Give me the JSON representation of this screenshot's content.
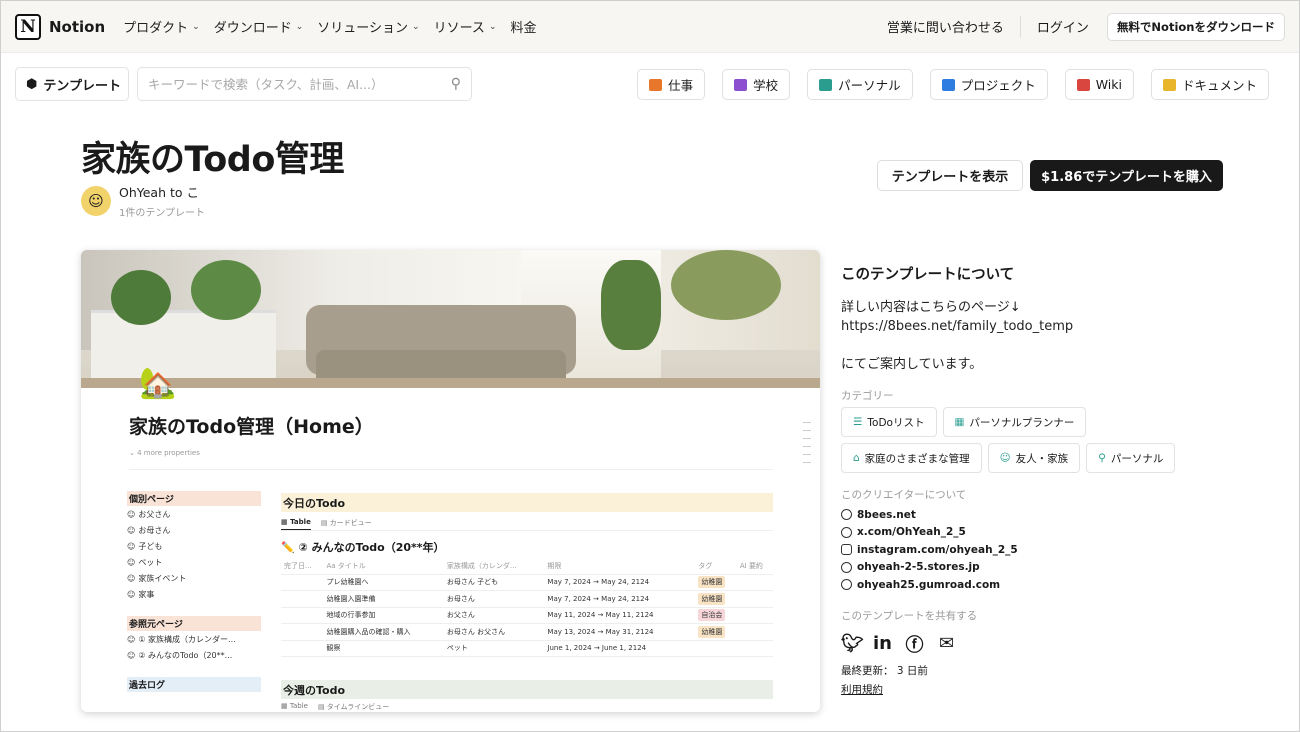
{
  "nav": {
    "brand": "Notion",
    "items": [
      "プロダクト",
      "ダウンロード",
      "ソリューション",
      "リソース",
      "料金"
    ],
    "has_chevron": [
      true,
      true,
      true,
      true,
      false
    ],
    "contact": "営業に問い合わせる",
    "login": "ログイン",
    "download": "無料でNotionをダウンロード"
  },
  "toolbar": {
    "templates_label": "テンプレート",
    "search_placeholder": "キーワードで検索（タスク、計画、AI...）",
    "categories": [
      {
        "label": "仕事",
        "color": "#e9772b"
      },
      {
        "label": "学校",
        "color": "#8b4fcf"
      },
      {
        "label": "パーソナル",
        "color": "#2a9d8f"
      },
      {
        "label": "プロジェクト",
        "color": "#2f7de1"
      },
      {
        "label": "Wiki",
        "color": "#d9463f"
      },
      {
        "label": "ドキュメント",
        "color": "#e8b52b"
      }
    ]
  },
  "template": {
    "title": "家族のTodo管理",
    "author": "OhYeah to こ",
    "author_sub": "1件のテンプレート",
    "view_button": "テンプレートを表示",
    "buy_button": "$1.86でテンプレートを購入"
  },
  "preview": {
    "page_title": "家族のTodo管理（Home）",
    "more_props": "4 more properties",
    "sections": [
      {
        "heading": "個別ページ",
        "color": "#f9e2d6",
        "items": [
          "お父さん",
          "お母さん",
          "子ども",
          "ペット",
          "家族イベント",
          "家事"
        ]
      },
      {
        "heading": "参照元ページ",
        "color": "#f9e2d6",
        "items": [
          "① 家族構成（カレンダー...",
          "② みんなのTodo（20**..."
        ]
      },
      {
        "heading": "過去ログ",
        "color": "#e3eef7",
        "items": []
      }
    ],
    "today": "今日のTodo",
    "tab_table": "Table",
    "tab_card": "カードビュー",
    "db_title": "② みんなのTodo（20**年）",
    "columns": [
      "完了日...",
      "Aa タイトル",
      "家族構成（カレンダ...",
      "期限",
      "タグ",
      "AI 要約"
    ],
    "rows": [
      {
        "title": "プレ幼稚園へ",
        "members": "お母さん  子ども",
        "date": "May 7, 2024 → May 24, 2124",
        "tag": "幼稚園",
        "tag_color": "#f8e3c4"
      },
      {
        "title": "幼稚園入園準備",
        "members": "お母さん",
        "date": "May 7, 2024 → May 24, 2124",
        "tag": "幼稚園",
        "tag_color": "#f8e3c4"
      },
      {
        "title": "地域の行事参加",
        "members": "お父さん",
        "date": "May 11, 2024 → May 11, 2124",
        "tag": "自治会",
        "tag_color": "#f7d6d9"
      },
      {
        "title": "幼稚園購入品の確認・購入",
        "members": "お母さん  お父さん",
        "date": "May 13, 2024 → May 31, 2124",
        "tag": "幼稚園",
        "tag_color": "#f8e3c4"
      },
      {
        "title": "観察",
        "members": "ペット",
        "date": "June 1, 2024 → June 1, 2124",
        "tag": "",
        "tag_color": "#ffffff"
      }
    ],
    "week": "今週のTodo",
    "week_tab2": "タイムラインビュー"
  },
  "info": {
    "heading": "このテンプレートについて",
    "desc1": "詳しい内容はこちらのページ↓",
    "desc2": "https://8bees.net/family_todo_temp",
    "desc3": "にてご案内しています。",
    "category_label": "カテゴリー",
    "chips": [
      {
        "label": "ToDoリスト",
        "icon": "☰",
        "color": "#2a9d8f"
      },
      {
        "label": "パーソナルプランナー",
        "icon": "▦",
        "color": "#2a9d8f"
      },
      {
        "label": "家庭のさまざまな管理",
        "icon": "⌂",
        "color": "#2a9d8f"
      },
      {
        "label": "友人・家族",
        "icon": "☺",
        "color": "#2a9d8f"
      },
      {
        "label": "パーソナル",
        "icon": "⚲",
        "color": "#2a9d8f"
      }
    ],
    "creator_label": "このクリエイターについて",
    "links": [
      {
        "text": "8bees.net",
        "icon": "globe"
      },
      {
        "text": "x.com/OhYeah_2_5",
        "icon": "globe"
      },
      {
        "text": "instagram.com/ohyeah_2_5",
        "icon": "instagram"
      },
      {
        "text": "ohyeah-2-5.stores.jp",
        "icon": "globe"
      },
      {
        "text": "ohyeah25.gumroad.com",
        "icon": "globe"
      }
    ],
    "share_label": "このテンプレートを共有する",
    "share_icons": [
      "twitter-icon",
      "linkedin-icon",
      "facebook-icon",
      "mail-icon"
    ],
    "updated": "最終更新： 3 日前",
    "terms": "利用規約"
  }
}
